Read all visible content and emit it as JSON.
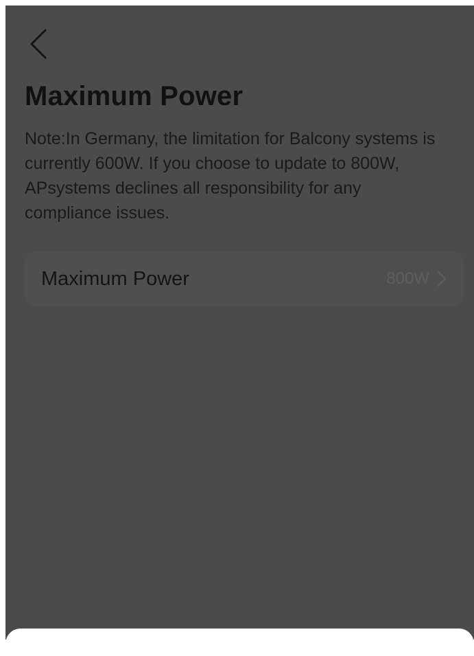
{
  "header": {
    "back_icon": "chevron-left-icon",
    "title": "Maximum Power"
  },
  "note": {
    "text": "Note:In Germany, the limitation for Balcony systems is currently 600W. If you choose to update to 800W, APsystems declines all responsibility for any compliance issues."
  },
  "settings": [
    {
      "label": "Maximum Power",
      "value": "800W",
      "icon": "chevron-right-icon"
    }
  ],
  "colors": {
    "overlay_background": "#4b4b4b",
    "row_background": "#4f4f4f",
    "title_text": "#111111",
    "value_text": "#5e5e5e",
    "sheet_background": "#ffffff"
  }
}
